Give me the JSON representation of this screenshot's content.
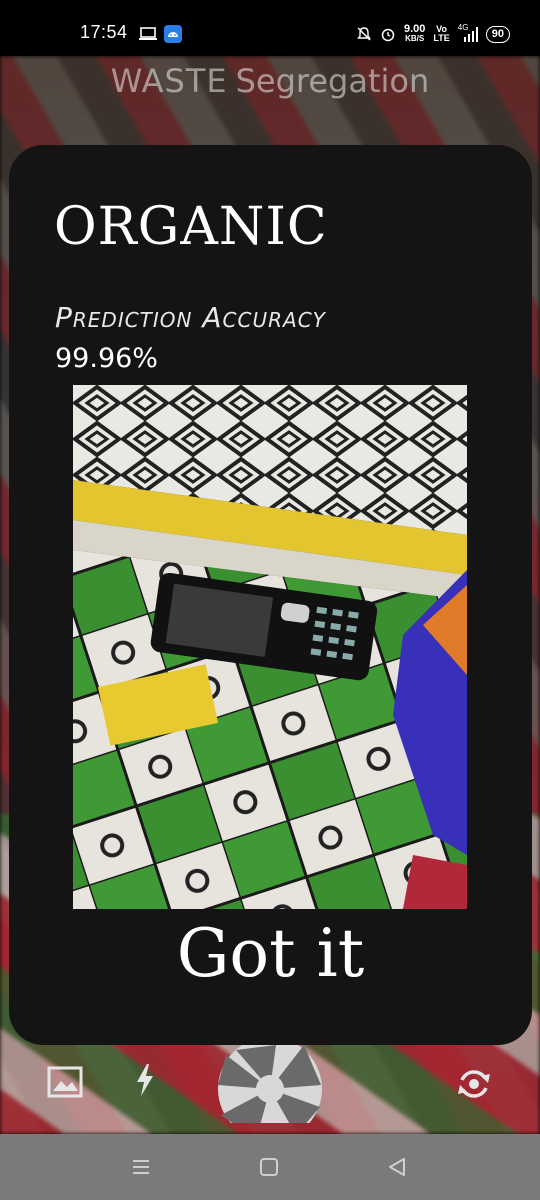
{
  "status_bar": {
    "time": "17:54",
    "net_speed": "9.00",
    "net_speed_unit": "KB/S",
    "volte_top": "Vo",
    "volte_bottom": "LTE",
    "network": "4G",
    "battery": "90",
    "icons": [
      "laptop-icon",
      "android-app-icon",
      "mute-bell-icon",
      "alarm-icon",
      "signal-icon"
    ]
  },
  "app_title": {
    "part1": "WASTE",
    "part2": "Segregation"
  },
  "result": {
    "label": "ORGANIC",
    "accuracy_caption": "Prediction Accuracy",
    "accuracy_value": "99.96%",
    "photo": "captured-photo (phone on patterned cloth)",
    "got_it_label": "Got it"
  },
  "camera_controls": {
    "icons": [
      "gallery-icon",
      "flash-icon",
      "shutter-icon",
      "switch-camera-icon"
    ]
  },
  "nav_bar": {
    "icons": [
      "recents-icon",
      "home-icon",
      "back-icon"
    ]
  },
  "colors": {
    "card_bg": "#141414",
    "nav_bg": "#7a7a7a",
    "status_bg": "#000000",
    "text": "#ffffff"
  }
}
